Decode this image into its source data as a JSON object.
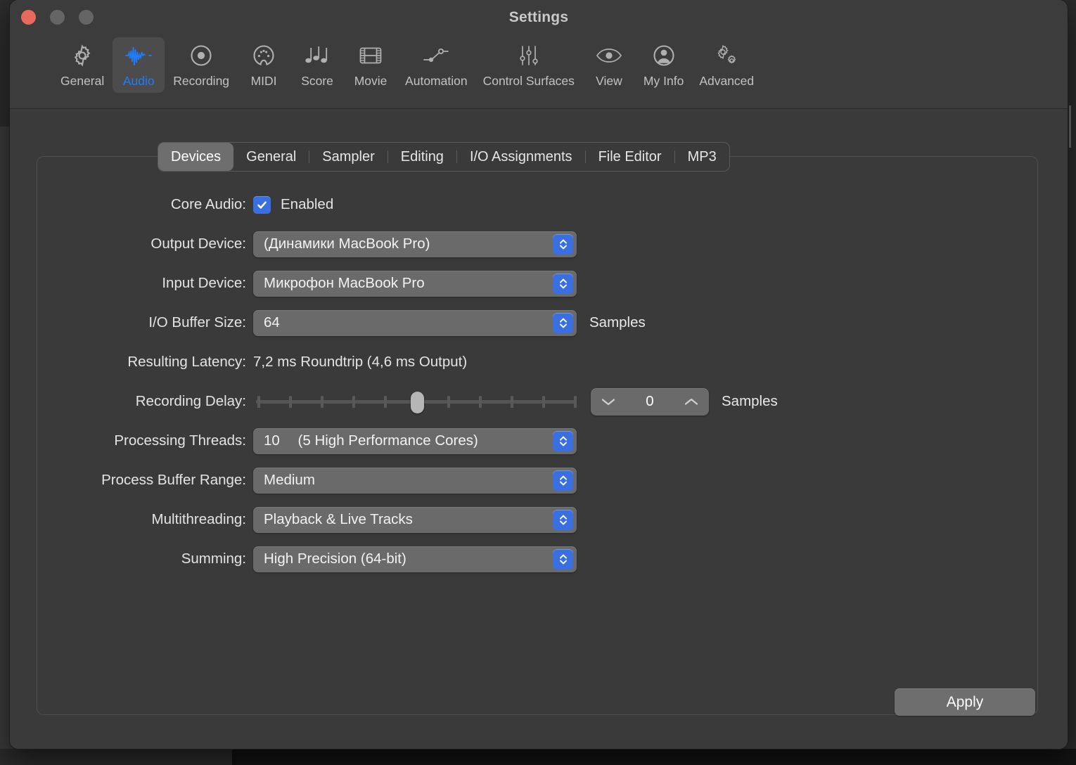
{
  "window": {
    "title": "Settings",
    "traffic_lights": [
      {
        "name": "close",
        "color": "#e9685c"
      },
      {
        "name": "minimize",
        "color": "#656565"
      },
      {
        "name": "zoom",
        "color": "#656565"
      }
    ]
  },
  "theme": {
    "accent_blue": "#3a6fe0",
    "selected_tab_blue": "#1d7dfc",
    "window_bg": "#3a3a3a",
    "titlebar_bg": "#3c3c3c",
    "control_bg": "#6a6a6a",
    "text": "#e4e4e4"
  },
  "toolbar": {
    "items": [
      {
        "label": "General",
        "icon": "gear-icon",
        "selected": false
      },
      {
        "label": "Audio",
        "icon": "waveform-icon",
        "selected": true
      },
      {
        "label": "Recording",
        "icon": "record-circle-icon",
        "selected": false
      },
      {
        "label": "MIDI",
        "icon": "midi-connector-icon",
        "selected": false
      },
      {
        "label": "Score",
        "icon": "music-notes-icon",
        "selected": false
      },
      {
        "label": "Movie",
        "icon": "film-strip-icon",
        "selected": false
      },
      {
        "label": "Automation",
        "icon": "automation-nodes-icon",
        "selected": false
      },
      {
        "label": "Control Surfaces",
        "icon": "sliders-icon",
        "selected": false
      },
      {
        "label": "View",
        "icon": "eye-icon",
        "selected": false
      },
      {
        "label": "My Info",
        "icon": "person-circle-icon",
        "selected": false
      },
      {
        "label": "Advanced",
        "icon": "double-gear-icon",
        "selected": false
      }
    ]
  },
  "tabs": [
    {
      "label": "Devices",
      "active": true
    },
    {
      "label": "General",
      "active": false
    },
    {
      "label": "Sampler",
      "active": false
    },
    {
      "label": "Editing",
      "active": false
    },
    {
      "label": "I/O Assignments",
      "active": false
    },
    {
      "label": "File Editor",
      "active": false
    },
    {
      "label": "MP3",
      "active": false
    }
  ],
  "form": {
    "core_audio": {
      "label": "Core Audio:",
      "checked": true,
      "checkbox_text": "Enabled"
    },
    "output_device": {
      "label": "Output Device:",
      "value": "(Динамики MacBook Pro)"
    },
    "input_device": {
      "label": "Input Device:",
      "value": "Микрофон MacBook Pro"
    },
    "io_buffer_size": {
      "label": "I/O Buffer Size:",
      "value": "64",
      "units": "Samples"
    },
    "resulting_latency": {
      "label": "Resulting Latency:",
      "value": "7,2 ms Roundtrip (4,6 ms Output)"
    },
    "recording_delay": {
      "label": "Recording Delay:",
      "value": "0",
      "units": "Samples",
      "slider_ticks": 11,
      "slider_position_index": 5,
      "slider_min": -5000,
      "slider_max": 5000
    },
    "processing_threads": {
      "label": "Processing Threads:",
      "value": "10",
      "value_detail": "(5 High Performance Cores)"
    },
    "process_buffer_range": {
      "label": "Process Buffer Range:",
      "value": "Medium"
    },
    "multithreading": {
      "label": "Multithreading:",
      "value": "Playback & Live Tracks"
    },
    "summing": {
      "label": "Summing:",
      "value": "High Precision (64-bit)"
    }
  },
  "actions": {
    "apply_label": "Apply"
  }
}
